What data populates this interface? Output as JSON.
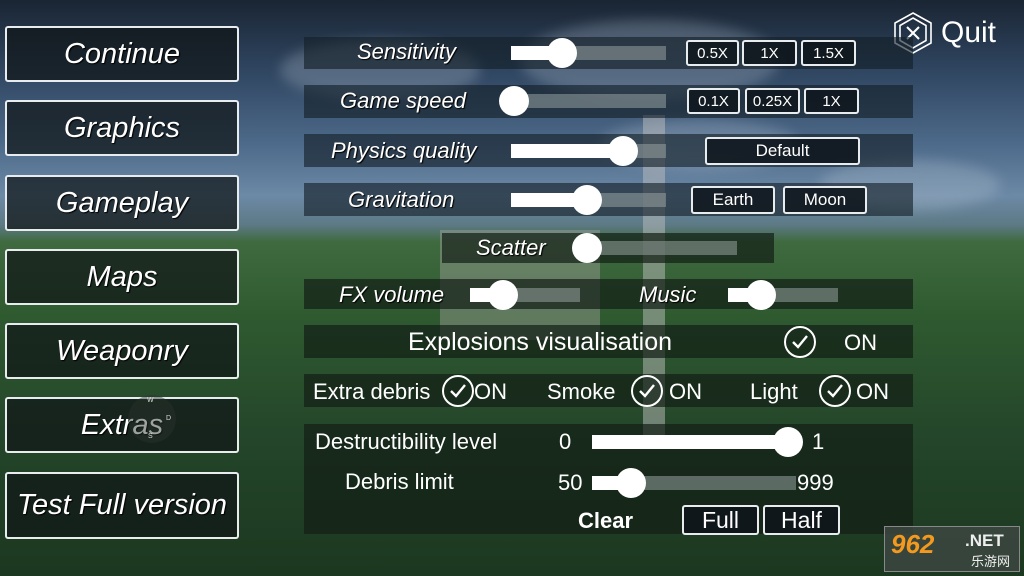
{
  "menu": {
    "items": [
      {
        "label": "Continue"
      },
      {
        "label": "Graphics"
      },
      {
        "label": "Gameplay"
      },
      {
        "label": "Maps"
      },
      {
        "label": "Weaponry"
      },
      {
        "label": "Extras"
      },
      {
        "label": "Test Full version"
      }
    ]
  },
  "quit": {
    "label": "Quit",
    "icon": "close-hexagon-icon"
  },
  "settings": {
    "sensitivity": {
      "label": "Sensitivity",
      "value": 0.33,
      "presets": [
        "0.5X",
        "1X",
        "1.5X"
      ]
    },
    "game_speed": {
      "label": "Game speed",
      "value": 0.0,
      "presets": [
        "0.1X",
        "0.25X",
        "1X"
      ]
    },
    "physics_quality": {
      "label": "Physics quality",
      "value": 0.72,
      "preset": "Default"
    },
    "gravitation": {
      "label": "Gravitation",
      "value": 0.49,
      "presets": [
        "Earth",
        "Moon"
      ]
    },
    "scatter": {
      "label": "Scatter",
      "value": 0.0
    },
    "fx_volume": {
      "label": "FX volume",
      "value": 0.3
    },
    "music": {
      "label": "Music",
      "value": 0.3
    },
    "explosions_visualisation": {
      "label": "Explosions visualisation",
      "state": "ON",
      "checked": true
    },
    "extra_debris": {
      "label": "Extra debris",
      "state": "ON",
      "checked": true
    },
    "smoke": {
      "label": "Smoke",
      "state": "ON",
      "checked": true
    },
    "light": {
      "label": "Light",
      "state": "ON",
      "checked": true
    },
    "destructibility": {
      "label": "Destructibility level",
      "min": "0",
      "max": "1",
      "value": 1.0
    },
    "debris_limit": {
      "label": "Debris limit",
      "min": "50",
      "max": "999",
      "value": 230
    },
    "clear_label": "Clear",
    "full_label": "Full",
    "half_label": "Half"
  },
  "compass": {
    "n": "W",
    "e": "D",
    "s": "S"
  },
  "watermark": {
    "number": "962",
    "net": ".NET",
    "cn": "乐游网"
  }
}
